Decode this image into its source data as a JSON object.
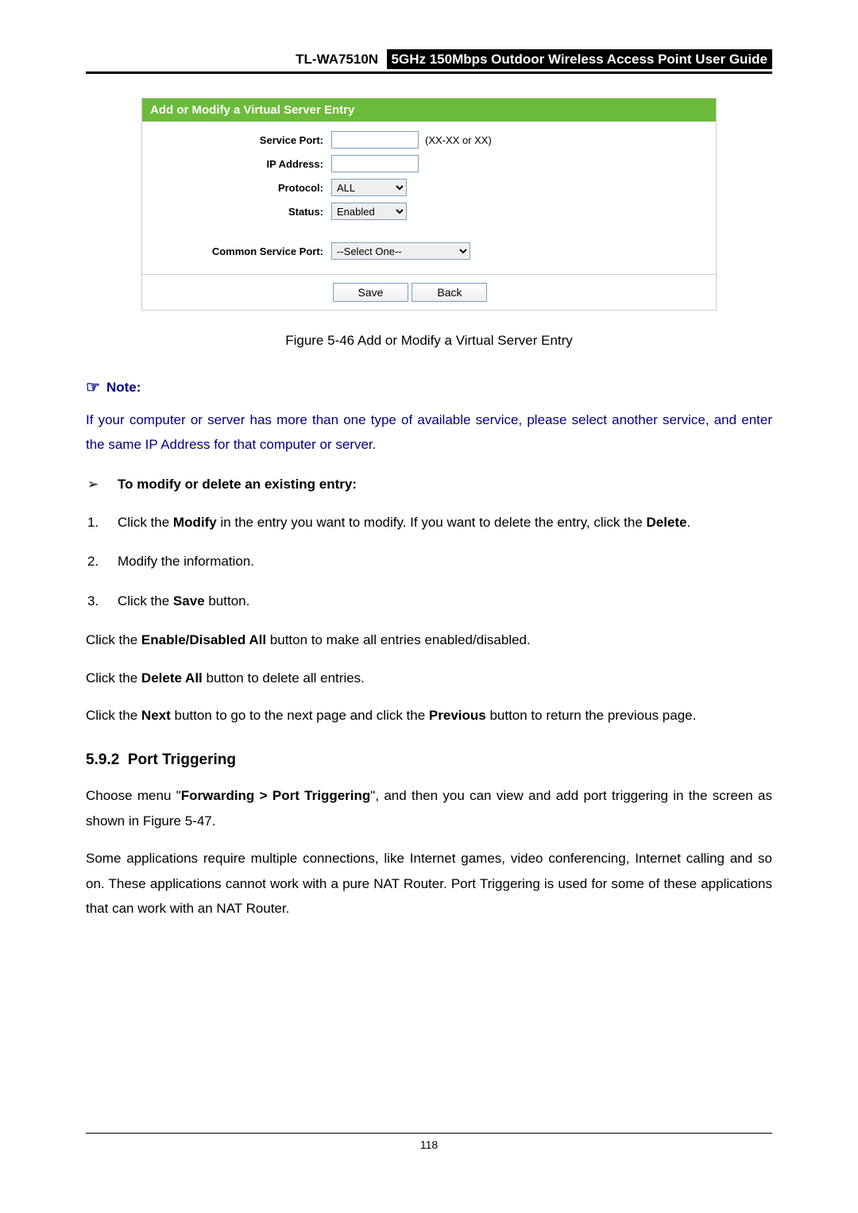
{
  "header": {
    "model": "TL-WA7510N",
    "title": "5GHz 150Mbps Outdoor Wireless Access Point User Guide"
  },
  "form": {
    "panel_title": "Add or Modify a Virtual Server Entry",
    "labels": {
      "service_port": "Service Port:",
      "ip_address": "IP Address:",
      "protocol": "Protocol:",
      "status": "Status:",
      "common_service_port": "Common Service Port:"
    },
    "values": {
      "protocol": "ALL",
      "status": "Enabled",
      "common_service_port": "--Select One--"
    },
    "hint": "(XX-XX or XX)",
    "buttons": {
      "save": "Save",
      "back": "Back"
    }
  },
  "caption": "Figure 5-46 Add or Modify a Virtual Server Entry",
  "note": {
    "label": "Note:",
    "text": "If your computer or server has more than one type of available service, please select another service, and enter the same IP Address for that computer or server."
  },
  "modify_heading": "To modify or delete an existing entry:",
  "steps": {
    "s1a": "Click the ",
    "s1b": "Modify",
    "s1c": " in the entry you want to modify. If you want to delete the entry, click the ",
    "s1d": "Delete",
    "s1e": ".",
    "s2": "Modify the information.",
    "s3a": "Click the ",
    "s3b": "Save",
    "s3c": " button."
  },
  "paras": {
    "p1a": "Click the ",
    "p1b": "Enable/Disabled All",
    "p1c": " button to make all entries enabled/disabled.",
    "p2a": "Click the ",
    "p2b": "Delete All",
    "p2c": " button to delete all entries.",
    "p3a": "Click the ",
    "p3b": "Next",
    "p3c": " button to go to the next page and click the ",
    "p3d": "Previous",
    "p3e": " button to return the previous page."
  },
  "section": {
    "number": "5.9.2",
    "title": "Port Triggering",
    "p1a": "Choose menu \"",
    "p1b": "Forwarding > Port Triggering",
    "p1c": "\", and then you can view and add port triggering in the screen as shown in Figure 5-47.",
    "p2": "Some applications require multiple connections, like Internet games, video conferencing, Internet calling and so on. These applications cannot work with a pure NAT Router. Port Triggering is used for some of these applications that can work with an NAT Router."
  },
  "page_number": "118"
}
